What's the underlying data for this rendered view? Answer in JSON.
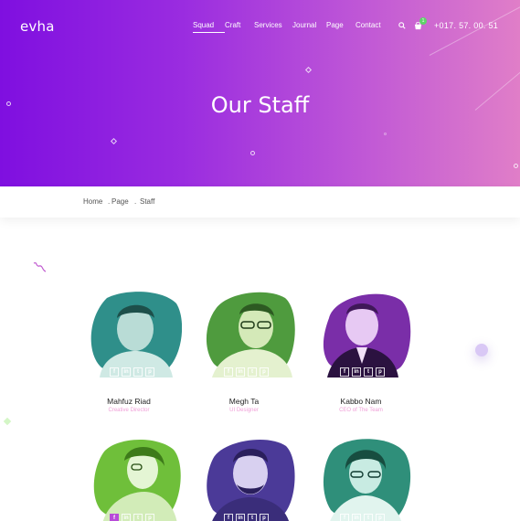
{
  "header": {
    "logo": "evha",
    "nav": [
      "Squad",
      "Craft",
      "Services",
      "Journal",
      "Page",
      "Contact"
    ],
    "active_nav": "Squad",
    "cart_count": "1",
    "phone": "+017. 57. 00. 51"
  },
  "hero": {
    "title": "Our Staff"
  },
  "breadcrumb": {
    "items": [
      "Home",
      ".",
      "Page",
      ".",
      "Staff"
    ]
  },
  "staff": [
    {
      "name": "Mahfuz Riad",
      "role": "Creative Director",
      "tint": "#2f8f8a"
    },
    {
      "name": "Megh Ta",
      "role": "UI Designer",
      "tint": "#4f9b3e"
    },
    {
      "name": "Kabbo Nam",
      "role": "CEO of The Team",
      "tint": "#7a2ea8"
    },
    {
      "name": "",
      "role": "",
      "tint": "#6fbf3a"
    },
    {
      "name": "",
      "role": "",
      "tint": "#4b3a98"
    },
    {
      "name": "",
      "role": "",
      "tint": "#2f8f7a"
    }
  ],
  "social_icons": [
    "f",
    "in",
    "t",
    "p"
  ],
  "colors": {
    "hero_start": "#7f0fe0",
    "hero_end": "#e07ec8",
    "accent_pink": "#f0a0d8",
    "cart_badge": "#5fd36a"
  }
}
